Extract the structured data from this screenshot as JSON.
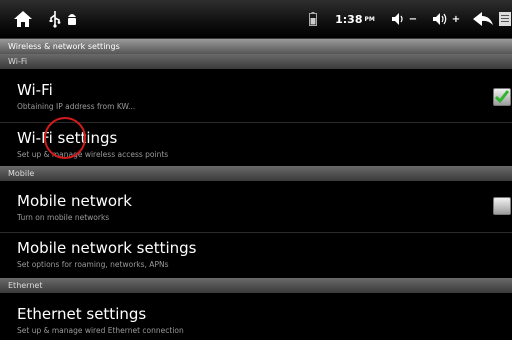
{
  "status_bar": {
    "time": "1:38",
    "ampm": "PM",
    "volume_down_label": "−",
    "volume_up_label": "+",
    "icons": [
      "home-icon",
      "usb-icon",
      "android-icon",
      "battery-icon",
      "volume-down-icon",
      "volume-up-icon",
      "back-icon",
      "menu-icon"
    ]
  },
  "page_title": "Wireless & network settings",
  "sections": [
    {
      "header": "Wi-Fi",
      "items": [
        {
          "title": "Wi-Fi",
          "subtitle": "Obtaining IP address from KW...",
          "checkbox": true,
          "checked": true
        },
        {
          "title": "Wi-Fi settings",
          "subtitle": "Set up & manage wireless access points"
        }
      ]
    },
    {
      "header": "Mobile",
      "items": [
        {
          "title": "Mobile network",
          "subtitle": "Turn on mobile networks",
          "checkbox": true,
          "checked": false
        },
        {
          "title": "Mobile network settings",
          "subtitle": "Set options for roaming, networks, APNs"
        }
      ]
    },
    {
      "header": "Ethernet",
      "items": [
        {
          "title": "Ethernet settings",
          "subtitle": "Set up & manage wired Ethernet connection"
        }
      ]
    }
  ],
  "colors": {
    "check": "#2fb52f",
    "tap_marker": "#d21a1a",
    "background": "#000000"
  }
}
